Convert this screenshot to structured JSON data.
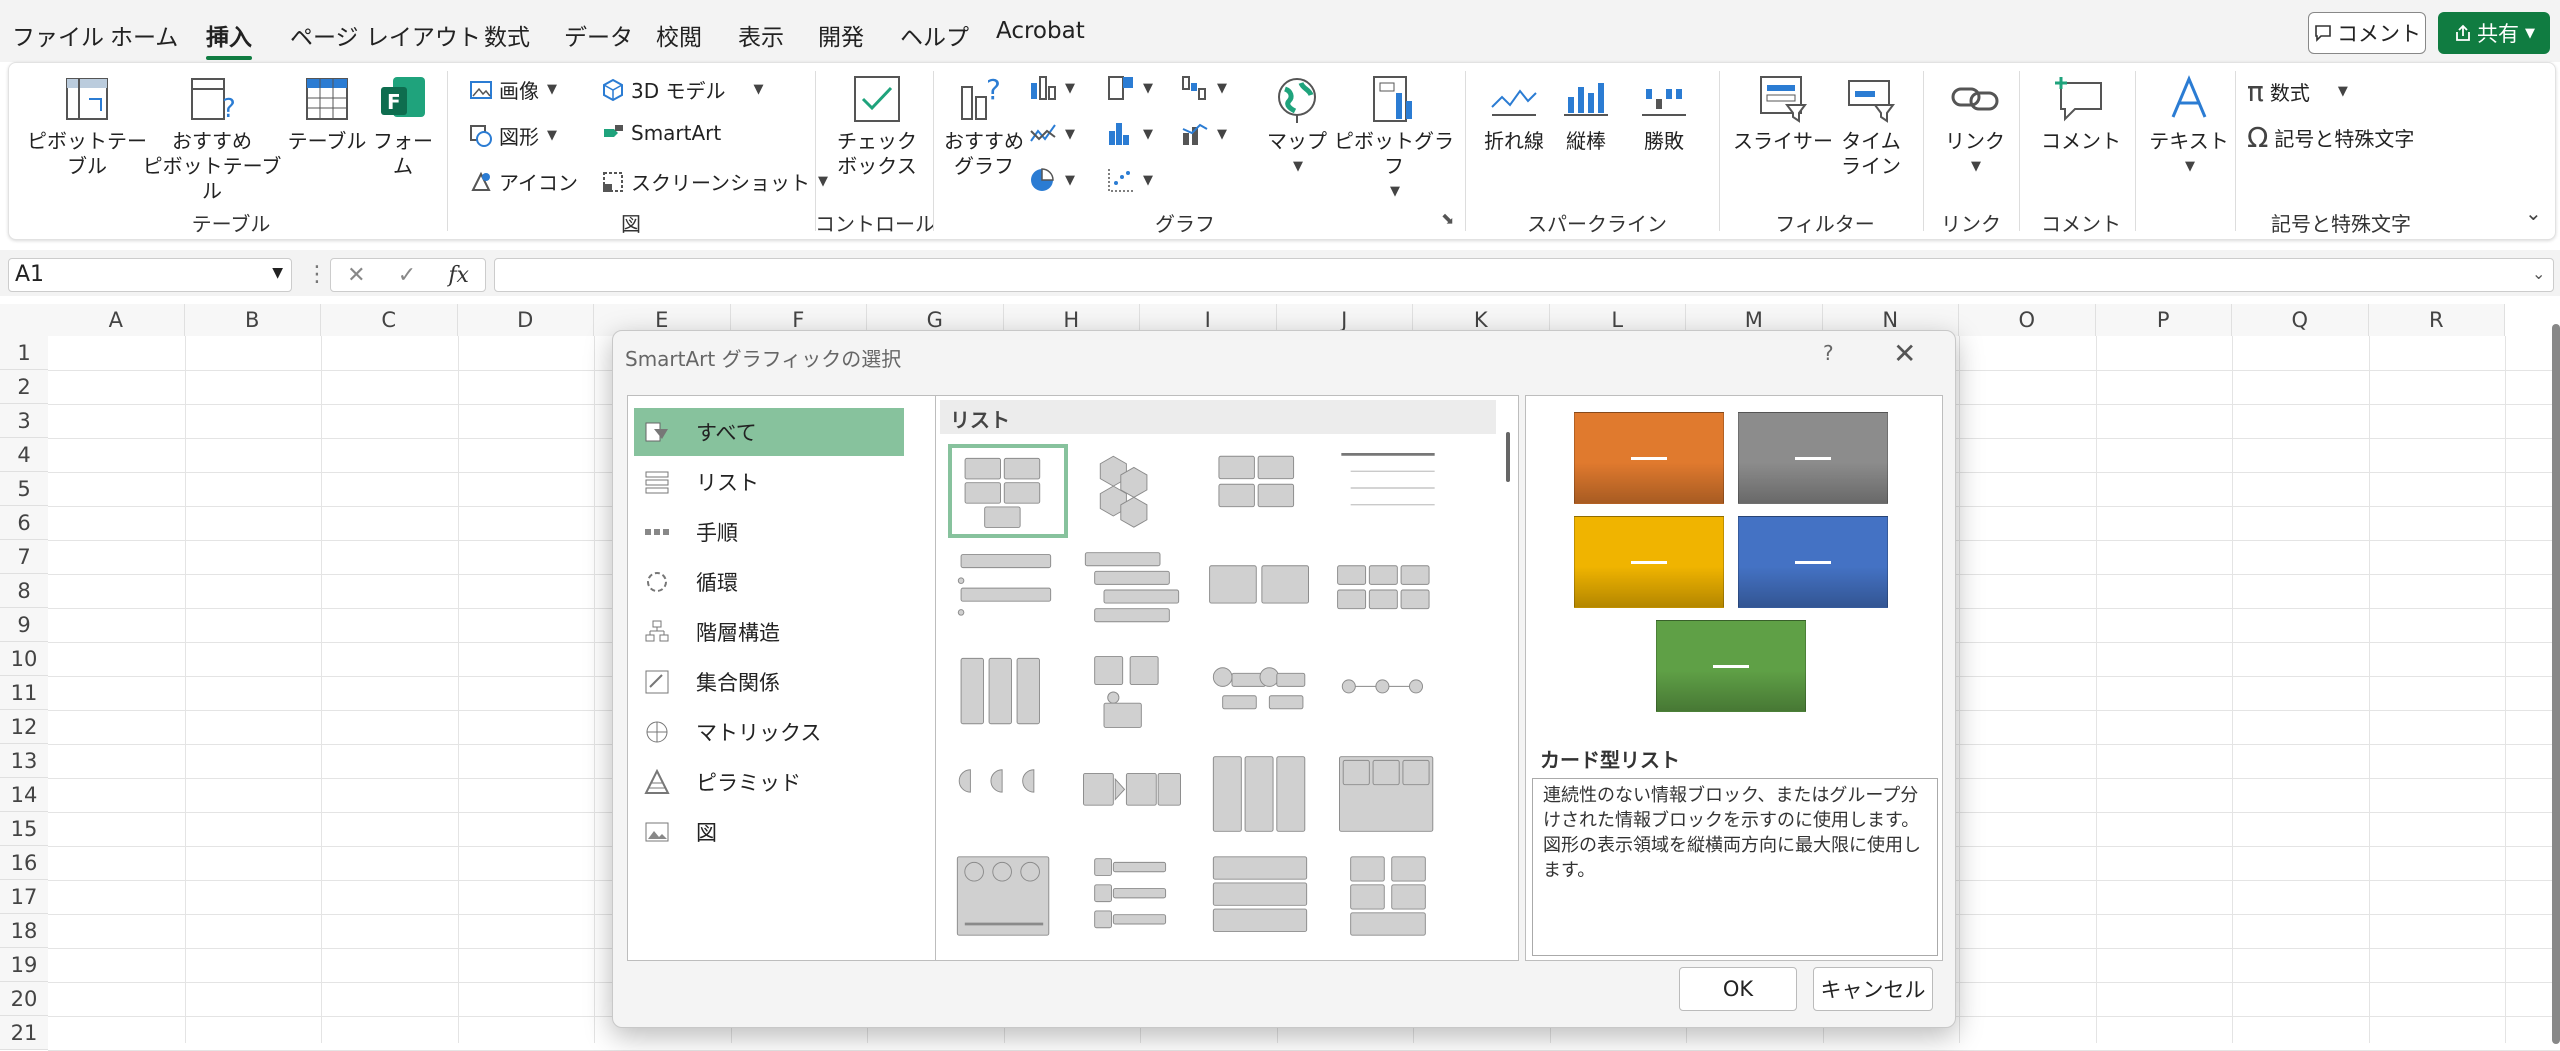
{
  "menu": {
    "tabs": [
      "ファイル",
      "ホーム",
      "挿入",
      "ページ レイアウト",
      "数式",
      "データ",
      "校閲",
      "表示",
      "開発",
      "ヘルプ",
      "Acrobat"
    ],
    "comment_btn": "コメント",
    "share_btn": "共有"
  },
  "ribbon": {
    "groups": {
      "table": "テーブル",
      "illustrations": "図",
      "controls": "コントロール",
      "charts": "グラフ",
      "sparklines": "スパークライン",
      "filters": "フィルター",
      "links": "リンク",
      "comments": "コメント",
      "symbols": "記号と特殊文字"
    },
    "buttons": {
      "pivot_l1": "ピボットテー",
      "pivot_l2": "ブル",
      "rec_pivot_l1": "おすすめ",
      "rec_pivot_l2": "ピボットテーブル",
      "table": "テーブル",
      "forms_l1": "フォー",
      "forms_l2": "ム",
      "image": "画像",
      "model3d": "3D モデル",
      "shapes": "図形",
      "smartart": "SmartArt",
      "icons": "アイコン",
      "screenshot": "スクリーンショット",
      "checkbox_l1": "チェック",
      "checkbox_l2": "ボックス",
      "rec_chart_l1": "おすすめ",
      "rec_chart_l2": "グラフ",
      "map": "マップ",
      "pivot_chart": "ピボットグラフ",
      "line": "折れ線",
      "column": "縦棒",
      "winloss": "勝敗",
      "slicer": "スライサー",
      "timeline_l1": "タイム",
      "timeline_l2": "ライン",
      "link": "リンク",
      "comment": "コメント",
      "text": "テキスト",
      "equation": "数式",
      "symbol": "記号と特殊文字"
    }
  },
  "formula_bar": {
    "name_box": "A1",
    "fx": "fx"
  },
  "grid": {
    "columns": [
      "A",
      "B",
      "C",
      "D",
      "E",
      "F",
      "G",
      "H",
      "I",
      "J",
      "K",
      "L",
      "M",
      "N",
      "O",
      "P",
      "Q",
      "R"
    ],
    "rows": [
      "1",
      "2",
      "3",
      "4",
      "5",
      "6",
      "7",
      "8",
      "9",
      "10",
      "11",
      "12",
      "13",
      "14",
      "15",
      "16",
      "17",
      "18",
      "19",
      "20",
      "21"
    ]
  },
  "dialog": {
    "title": "SmartArt グラフィックの選択",
    "help": "?",
    "close": "✕",
    "categories": [
      "すべて",
      "リスト",
      "手順",
      "循環",
      "階層構造",
      "集合関係",
      "マトリックス",
      "ピラミッド",
      "図"
    ],
    "section_header": "リスト",
    "preview_colors": [
      "#e07a2e",
      "#8c8c8c",
      "#f0b400",
      "#4472c4",
      "#5fa046"
    ],
    "layout_name": "カード型リスト",
    "layout_desc": "連続性のない情報ブロック、またはグループ分けされた情報ブロックを示すのに使用します。図形の表示領域を縦横両方向に最大限に使用します。",
    "ok": "OK",
    "cancel": "キャンセル"
  }
}
